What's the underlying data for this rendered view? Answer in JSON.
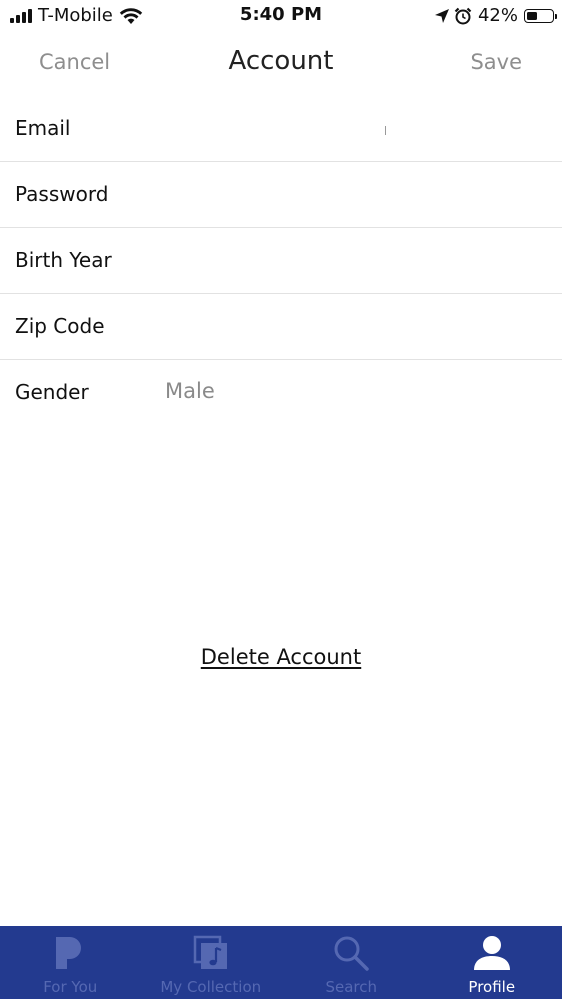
{
  "status_bar": {
    "carrier": "T-Mobile",
    "time": "5:40 PM",
    "battery_percent": "42%",
    "battery_level": 0.42
  },
  "nav": {
    "cancel_label": "Cancel",
    "title": "Account",
    "save_label": "Save"
  },
  "form": {
    "rows": [
      {
        "label": "Email",
        "value": ""
      },
      {
        "label": "Password",
        "value": ""
      },
      {
        "label": "Birth Year",
        "value": ""
      },
      {
        "label": "Zip Code",
        "value": ""
      },
      {
        "label": "Gender",
        "value": "Male"
      }
    ]
  },
  "delete_label": "Delete Account",
  "tabs": [
    {
      "label": "For You",
      "icon": "pandora-p-icon",
      "active": false
    },
    {
      "label": "My Collection",
      "icon": "music-collection-icon",
      "active": false
    },
    {
      "label": "Search",
      "icon": "search-icon",
      "active": false
    },
    {
      "label": "Profile",
      "icon": "profile-icon",
      "active": true
    }
  ],
  "colors": {
    "tab_bar_bg": "#233a8f",
    "tab_inactive": "#5568b2",
    "tab_active": "#ffffff",
    "nav_action": "#8e8e8e"
  }
}
